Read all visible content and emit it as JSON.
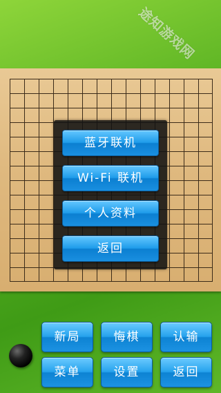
{
  "watermark": "途知游戏网",
  "menu": {
    "bluetooth": "蓝牙联机",
    "wifi": "Wi-Fi 联机",
    "profile": "个人资料",
    "back": "返回"
  },
  "controls": {
    "new_game": "新局",
    "undo": "悔棋",
    "resign": "认输",
    "menu": "菜单",
    "settings": "设置",
    "back": "返回"
  },
  "board": {
    "lines": 15
  },
  "colors": {
    "background": "#5bb323",
    "board": "#dfb97f",
    "button": "#1f9cea",
    "panel": "#121212"
  },
  "current_stone": "black"
}
